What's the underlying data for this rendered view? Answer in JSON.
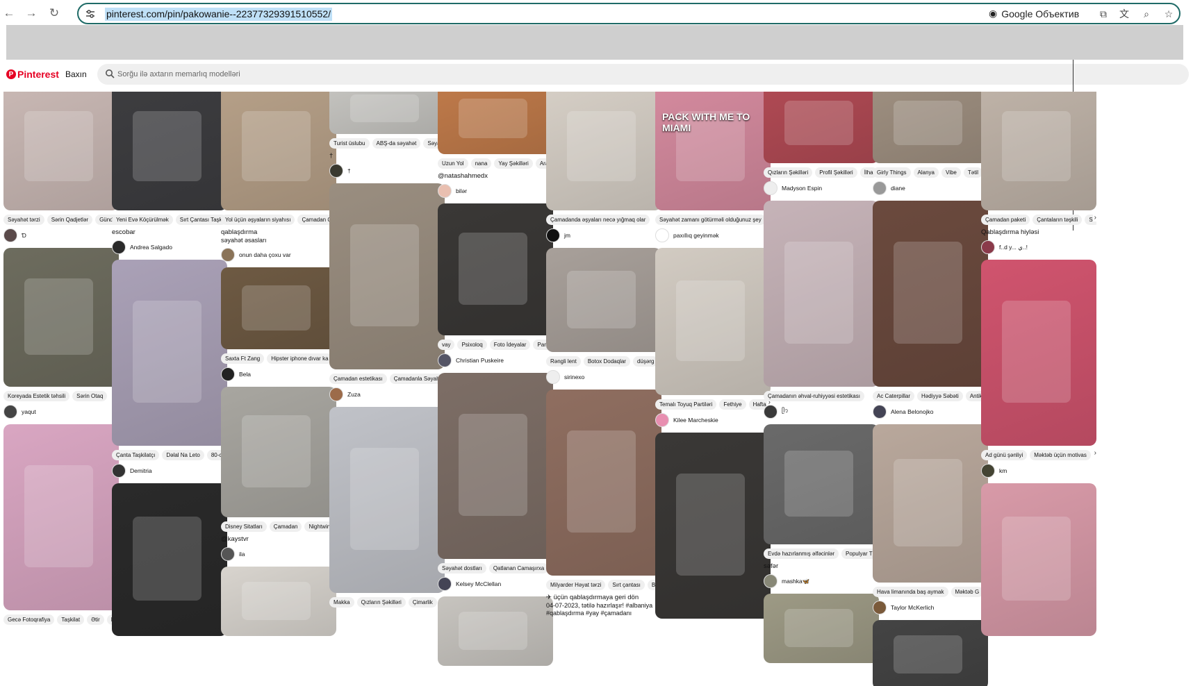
{
  "browser": {
    "url": "pinterest.com/pin/pakowanie--22377329391510552/",
    "lens_label": "Google Объектив"
  },
  "pinterest": {
    "logo_text": "Pinterest",
    "explore_label": "Baxın",
    "search_placeholder": "Sorğu ilə axtarın memarlıq modelləri"
  },
  "columns": [
    [
      {
        "img": "#c9b8b4",
        "h": 183,
        "tags": [
          "Səyahət tərzi",
          "Sərin Qadjetlər",
          "Gündə"
        ],
        "author": "Ɗ",
        "av": "#5a4a4a"
      },
      {
        "img": "#6d6c5e",
        "h": 200,
        "tags": [
          "Koreyada Estetik təhsili",
          "Sərin Otaq"
        ],
        "author": "yaqut",
        "av": "#444"
      },
      {
        "img": "#d9a6c2",
        "h": 268,
        "tags": [
          "Gecə Fotoqrafiya",
          "Taşkilat",
          "Ətir",
          "K"
        ],
        "author": "",
        "av": ""
      }
    ],
    [
      {
        "img": "#3d3d40",
        "h": 183,
        "tags": [
          "Yeni Evə Köçürülmək",
          "Sırt Çantası Taşk"
        ],
        "title": "escobar",
        "author": "Andrea Salgado",
        "av": "#2a2a2a"
      },
      {
        "img": "#aaa1b7",
        "h": 268,
        "tags": [
          "Çanta Taşkilatçı",
          "Dəlal Na Leto",
          "80-c"
        ],
        "author": "Demitria",
        "av": "#333"
      },
      {
        "img": "#2a2a2a",
        "h": 220,
        "tags": [],
        "author": "",
        "av": ""
      }
    ],
    [
      {
        "img": "#b6a088",
        "h": 183,
        "tags": [
          "Yol üçün əşyaların siyahısı",
          "Çamadan Q"
        ],
        "title": "qablaşdırma",
        "sub": "səyahət əsasları",
        "author": "onun daha çoxu var",
        "av": "#8a7358"
      },
      {
        "img": "#6e5a43",
        "h": 118,
        "tags": [
          "Saxta Ft Zang",
          "Hipster iphone dıvar ka"
        ],
        "author": "Bela",
        "av": "#222"
      },
      {
        "img": "#a8a6a0",
        "h": 188,
        "tags": [
          "Disney Sitatları",
          "Çamadan",
          "Nightwin"
        ],
        "title": "@kaystvr",
        "author": "ila",
        "av": "#555"
      },
      {
        "img": "#d8d4ce",
        "h": 100,
        "tags": [],
        "author": "",
        "av": ""
      }
    ],
    [
      {
        "img": "#c5c4c0",
        "h": 73,
        "tags": [
          "Turist üslubu",
          "ABŞ-da səyahət",
          "Səyah"
        ],
        "title": "†",
        "author": "†",
        "av": "#3a3a30"
      },
      {
        "img": "#9a8e80",
        "h": 268,
        "tags": [
          "Çamadan estetikası",
          "Çamadanla Səyah"
        ],
        "author": "Zuza",
        "av": "#9c6b4a"
      },
      {
        "img": "#c0c2c8",
        "h": 268,
        "tags": [
          "Makka",
          "Qızların Şəkilləri",
          "Çimarlik"
        ],
        "author": "",
        "av": ""
      }
    ],
    [
      {
        "img": "#bf7a4a",
        "h": 102,
        "tags": [
          "Uzun Yol",
          "nana",
          "Yay Şəkilləri",
          "Ara"
        ],
        "title": "@natashahmedx",
        "author": "bilər",
        "av": "#e9bfb0"
      },
      {
        "img": "#3a3836",
        "h": 190,
        "tags": [
          "vay",
          "Psixoloq",
          "Foto İdeyalar",
          "Parça"
        ],
        "author": "Christian Puskeire",
        "av": "#556"
      },
      {
        "img": "#7d6e66",
        "h": 268,
        "tags": [
          "Səyahət dostları",
          "Qatlanan Camaşırxa"
        ],
        "author": "Kelsey McClellan",
        "av": "#445"
      },
      {
        "img": "#c7c4bf",
        "h": 100,
        "tags": [],
        "author": "",
        "av": ""
      }
    ],
    [
      {
        "img": "#d6cfc6",
        "h": 183,
        "tags": [
          "Çamadanda əşyaları necə yığmaq olar"
        ],
        "author": "jm",
        "av": "#111"
      },
      {
        "img": "#a8a09a",
        "h": 150,
        "tags": [
          "Rəngli lent",
          "Botox Dodaqlar",
          "düşərg"
        ],
        "author": "sirinexo",
        "av": "#eee"
      },
      {
        "img": "#8f6e60",
        "h": 268,
        "tags": [
          "Milyarder Həyat tərzi",
          "Sırt çantası",
          "B"
        ],
        "title": "✈ üçün qablaşdırmaya geri dön",
        "sub": "04-07-2023, tətilə hazırlaşır! #albaniya #qablaşdırma #yay #çamadanı",
        "author": "",
        "av": ""
      }
    ],
    [
      {
        "img": "#d48a9e",
        "h": 183,
        "overlay": "PACK WITH ME TO MIAMI",
        "tags": [
          "Səyahət zamanı götürməli olduğunuz şey"
        ],
        "author": "paxıllıq geyinmək",
        "av": "#fff"
      },
      {
        "img": "#d2cbc2",
        "h": 212,
        "tags": [
          "Temalı Toyuq Partiləri",
          "Fethiye",
          "Hafta"
        ],
        "author": "Kilee Marcheskie",
        "av": "#e88fb0"
      },
      {
        "img": "#3a3836",
        "h": 268,
        "tags": [],
        "author": "",
        "av": ""
      }
    ],
    [
      {
        "img": "#b04a54",
        "h": 115,
        "tags": [
          "Qızların Şəkilləri",
          "Profil Şəkilləri",
          "İlha"
        ],
        "author": "Madyson Espin",
        "av": "#eee"
      },
      {
        "img": "#c6b3b8",
        "h": 268,
        "tags": [
          "Çamadanın əhval-ruhiyyəsi estetikası"
        ],
        "author": "ᥫ᭡",
        "av": "#3a3a3a"
      },
      {
        "img": "#6a6a6a",
        "h": 173,
        "tags": [
          "Evdə hazırlanmış əlfəcinlər",
          "Populyar T"
        ],
        "title": "səfər",
        "author": "mashka🦋",
        "av": "#887"
      },
      {
        "img": "#9d9a85",
        "h": 100,
        "tags": [],
        "author": "",
        "av": ""
      }
    ],
    [
      {
        "img": "#9e8f80",
        "h": 115,
        "tags": [
          "Girly Things",
          "Alanya",
          "Vibe",
          "Tətil"
        ],
        "author": "diane",
        "av": "#999"
      },
      {
        "img": "#6b4a3e",
        "h": 268,
        "tags": [
          "Ac Caterpillar",
          "Hədiyyə Səbəti",
          "Antik"
        ],
        "author": "Alena Belonojko",
        "av": "#445"
      },
      {
        "img": "#b9a89c",
        "h": 228,
        "tags": [
          "Hava limanında baş aymak",
          "Məktəb G"
        ],
        "author": "Taylor McKerlich",
        "av": "#7a5a3a"
      },
      {
        "img": "#444",
        "h": 100,
        "tags": [],
        "author": "",
        "av": ""
      }
    ],
    [
      {
        "img": "#bfb3a8",
        "h": 183,
        "tags": [
          "Çamadan paketi",
          "Çantaların təşkili",
          "Sə"
        ],
        "title": "Qablaşdırma hiyləsi",
        "author": "f..d y... ي..!",
        "av": "#8a3a4a"
      },
      {
        "img": "#d0546e",
        "h": 268,
        "tags": [
          "Ad günü şənliyi",
          "Məktəb üçün motivas"
        ],
        "author": "km",
        "av": "#443"
      },
      {
        "img": "#d89aa8",
        "h": 220,
        "tags": [],
        "author": "",
        "av": ""
      }
    ]
  ]
}
